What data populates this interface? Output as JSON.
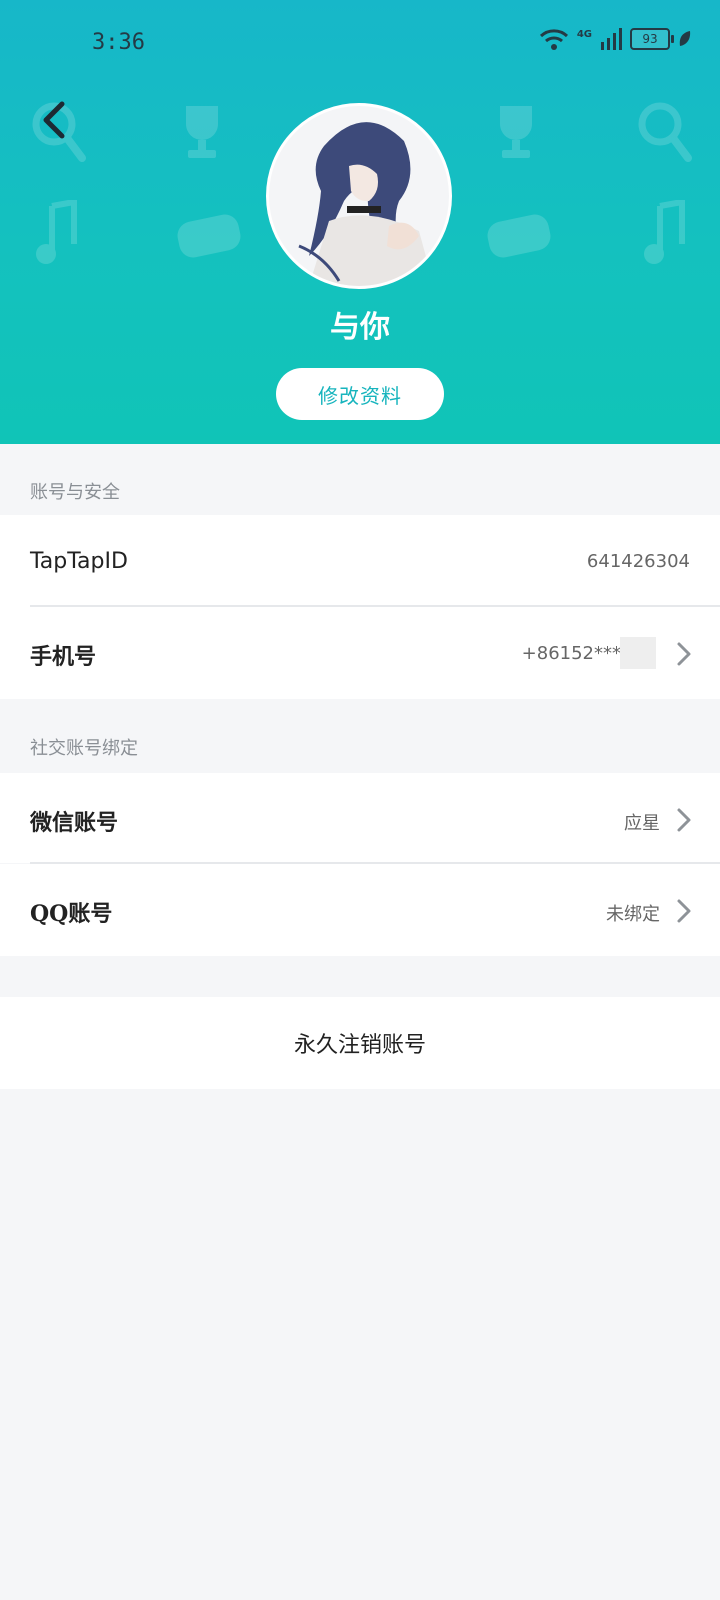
{
  "status_bar": {
    "time": "3:36",
    "network": "4G",
    "battery": "93"
  },
  "profile": {
    "nickname": "与你",
    "edit_button": "修改资料"
  },
  "account_security": {
    "title": "账号与安全",
    "taptap_id": {
      "label": "TapTapID",
      "value": "641426304"
    },
    "phone": {
      "label": "手机号",
      "value": "+86152****"
    }
  },
  "social_binding": {
    "title": "社交账号绑定",
    "wechat": {
      "label": "微信账号",
      "value": "应星"
    },
    "qq": {
      "label": "QQ账号",
      "value": "未绑定"
    }
  },
  "delete_account": "永久注销账号",
  "colors": {
    "header_top": "#17b7c9",
    "header_bottom": "#10c4b7",
    "accent": "#16b4bd",
    "background": "#f5f6f8"
  }
}
